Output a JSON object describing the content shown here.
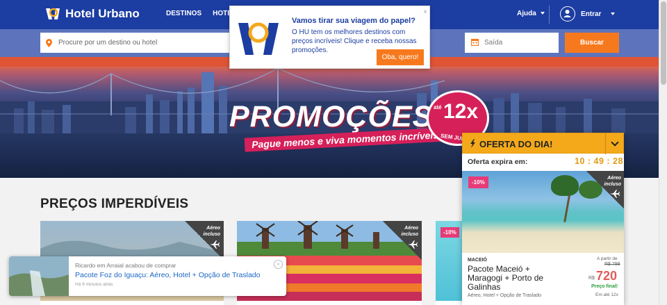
{
  "header": {
    "logo_text": "Hotel Urbano",
    "nav": [
      "DESTINOS",
      "HOTÉ"
    ],
    "help": "Ajuda",
    "login": "Entrar"
  },
  "search": {
    "placeholder": "Procure por um destino ou hotel",
    "checkout_label": "Saída",
    "button": "Buscar"
  },
  "banner": {
    "title": "PROMOÇÕES",
    "subtitle": "Pague menos e viva momentos incríveis.",
    "badge_prefix": "até",
    "badge_value": "12x",
    "badge_suffix": "SEM JUROS"
  },
  "section": {
    "title": "PREÇOS IMPERDÍVEIS"
  },
  "cards": [
    {
      "tag": "Aéreo incluso"
    },
    {
      "tag": "Aéreo incluso"
    },
    {
      "discount": "-10%"
    }
  ],
  "toast": {
    "line1": "Ricardo em Arraial acabou de comprar",
    "line2": "Pacote Foz do Iguaçu: Aéreo, Hotel + Opção de Traslado",
    "line3": "Há 9 minutos atrás"
  },
  "offer": {
    "title": "OFERTA DO DIA!",
    "expires_label": "Oferta expira em:",
    "timer": "10 : 49 : 28",
    "discount": "-10%",
    "tag": "Aéreo incluso",
    "region": "MACEIÓ",
    "name": "Pacote Maceió + Maragogi + Porto de Galinhas",
    "desc": "Aéreo, Hotel + Opção de Traslado",
    "from_label": "A partir de",
    "old_price": "R$ 799",
    "currency": "R$",
    "price": "720",
    "final_label": "Preço final!",
    "installments": "Em até 12x"
  },
  "popup": {
    "title": "Vamos tirar sua viagem do papel?",
    "body": "O HU tem os melhores destinos com preços incríveis! Clique e receba nossas promoções.",
    "button": "Oba, quero!",
    "close": "x"
  },
  "colors": {
    "brand_blue": "#1c3da1",
    "search_band": "#5d74bd",
    "orange": "#f7791d",
    "offer_yellow": "#f4a91b",
    "promo_pink": "#d6205a",
    "discount_pink": "#e73b78",
    "price_red": "#e35a5a"
  }
}
